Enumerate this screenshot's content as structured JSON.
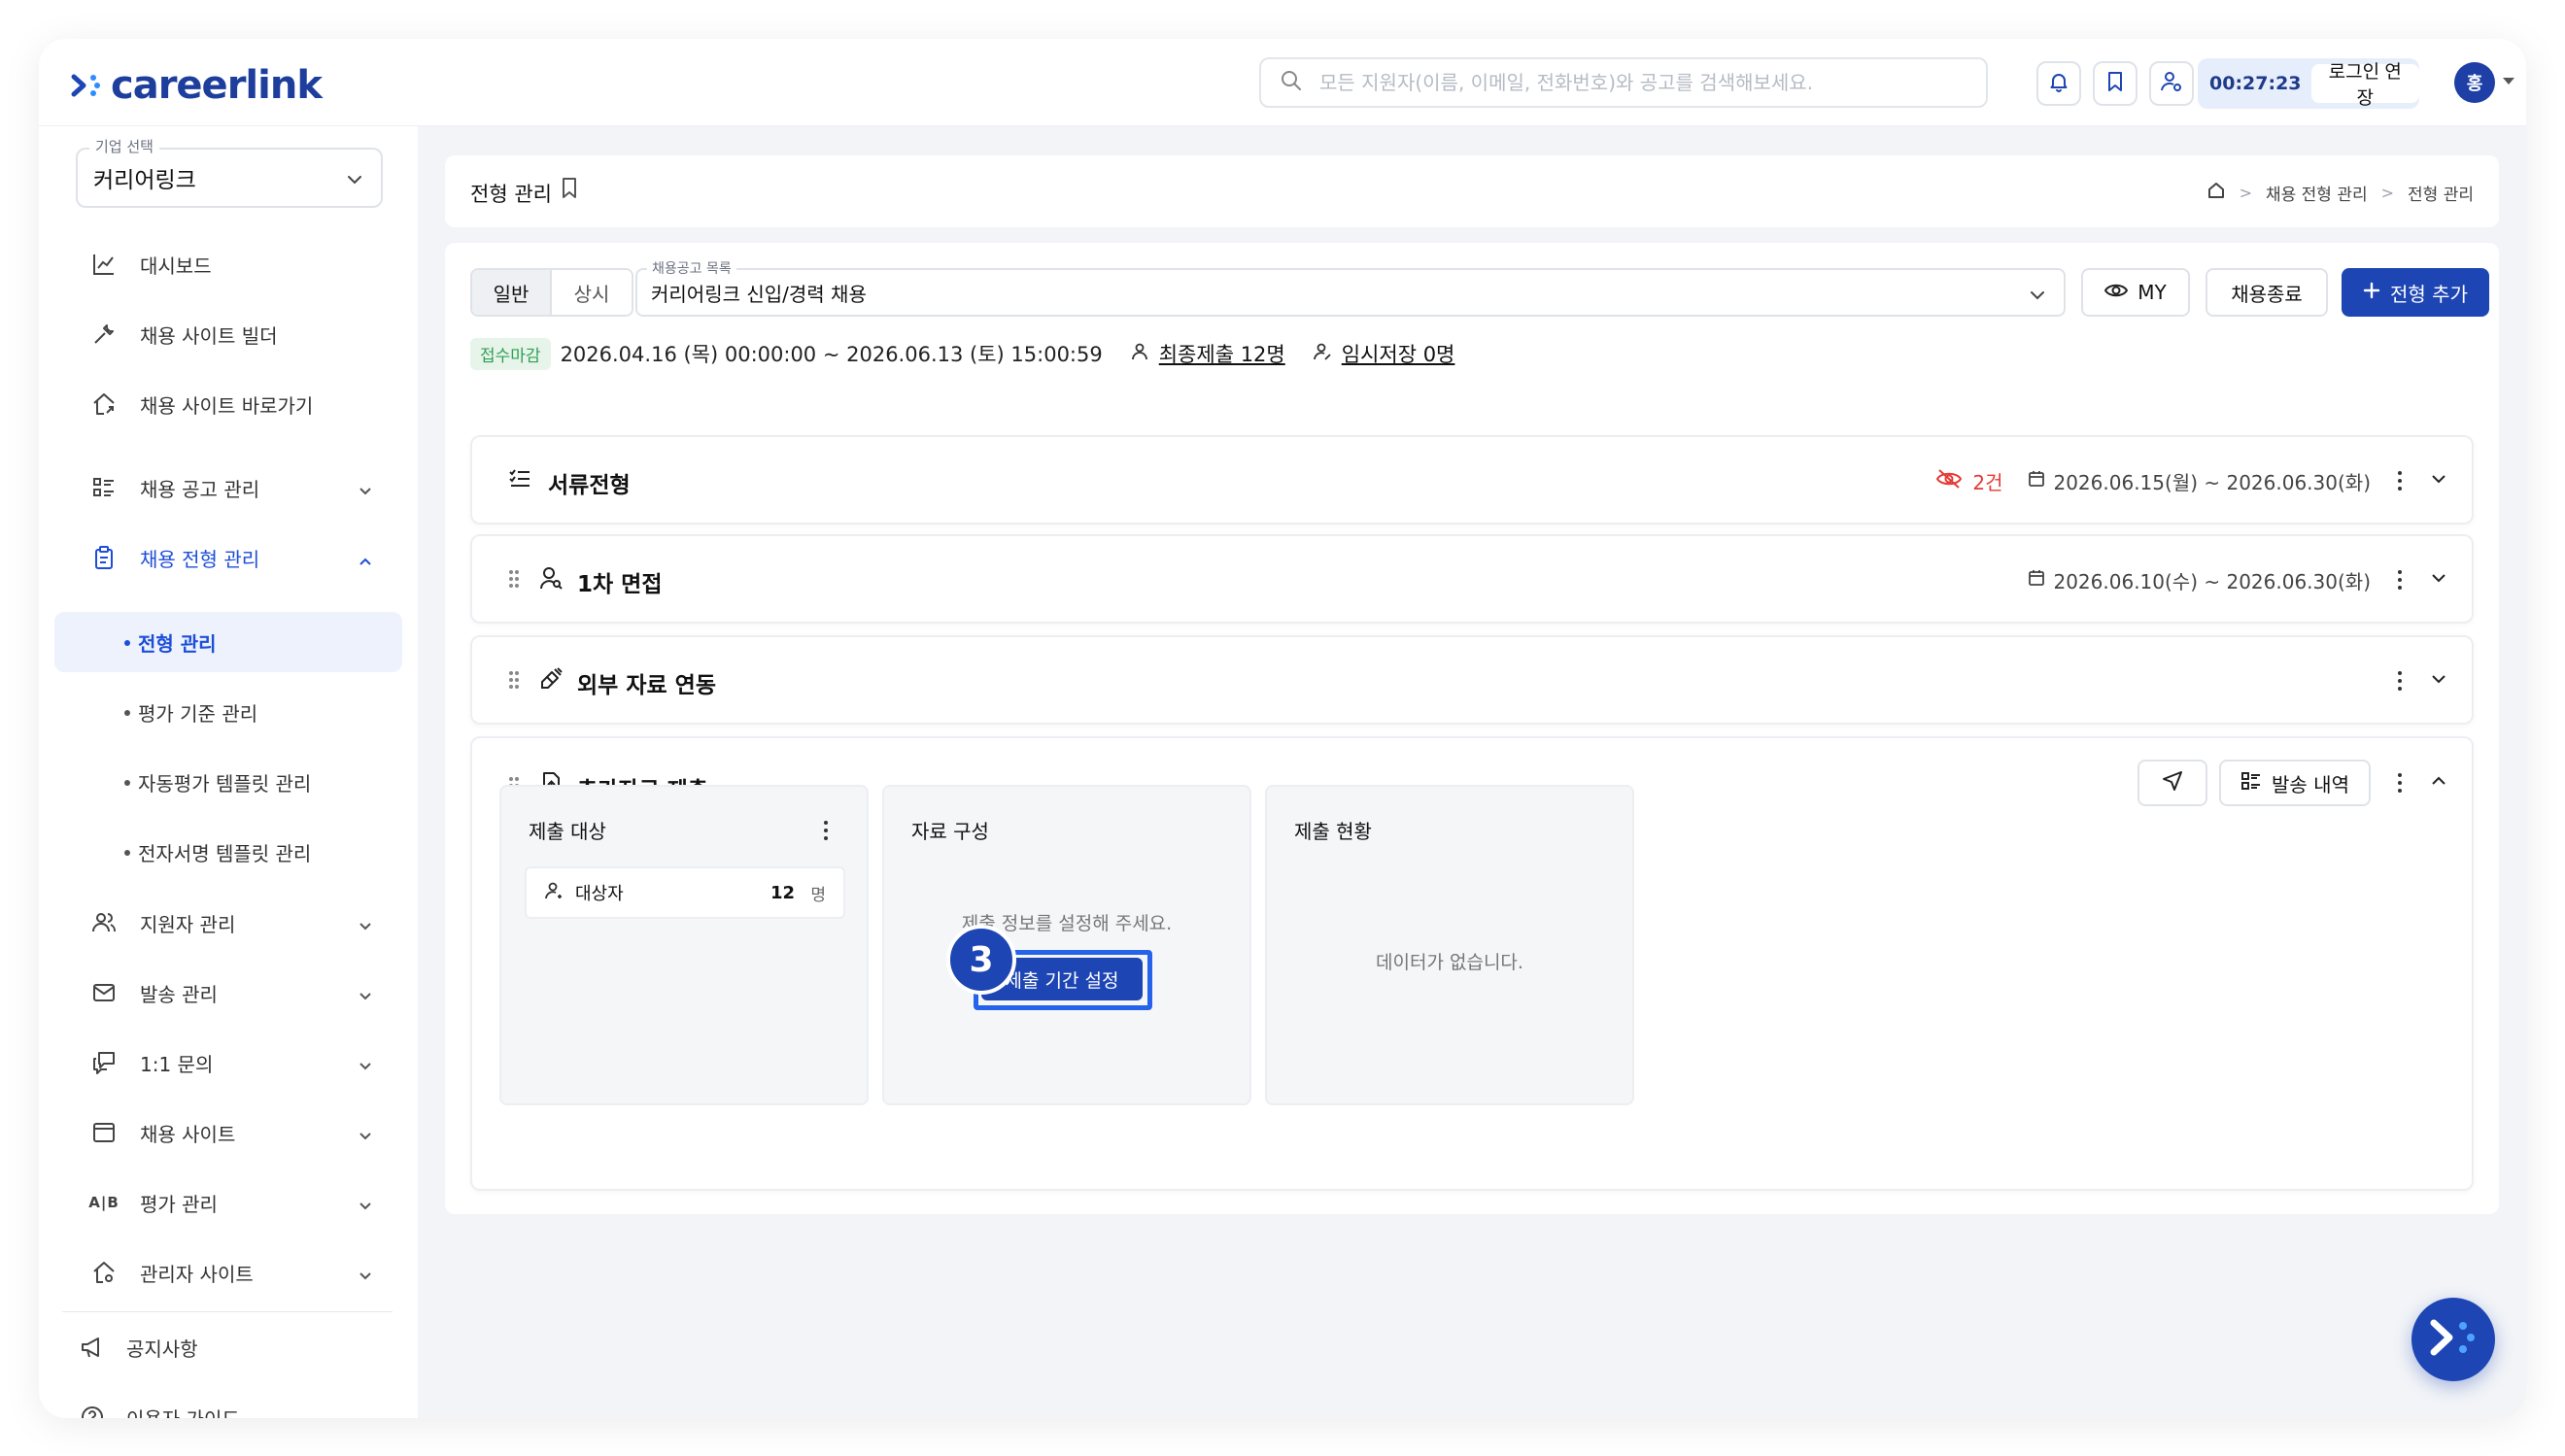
{
  "header": {
    "logo_text": "careerlink",
    "search_placeholder": "모든 지원자(이름, 이메일, 전화번호)와 공고를 검색해보세요.",
    "timer": "00:27:23",
    "extend_login": "로그인 연장",
    "avatar_initial": "홍"
  },
  "sidebar": {
    "company_legend": "기업 선택",
    "company_value": "커리어링크",
    "items": [
      {
        "label": "대시보드",
        "icon": "chart-icon"
      },
      {
        "label": "채용 사이트 빌더",
        "icon": "wrench-icon"
      },
      {
        "label": "채용 사이트 바로가기",
        "icon": "home-link-icon"
      },
      {
        "label": "채용 공고 관리",
        "icon": "list-icon"
      },
      {
        "label": "채용 전형 관리",
        "icon": "clipboard-icon"
      },
      {
        "label": "지원자 관리",
        "icon": "users-icon"
      },
      {
        "label": "발송 관리",
        "icon": "mail-icon"
      },
      {
        "label": "1:1 문의",
        "icon": "chat-icon"
      },
      {
        "label": "채용 사이트",
        "icon": "window-icon"
      },
      {
        "label": "평가 관리",
        "icon": "ab-icon"
      },
      {
        "label": "관리자 사이트",
        "icon": "admin-home-icon"
      }
    ],
    "subitems": [
      "전형 관리",
      "평가 기준 관리",
      "자동평가 템플릿 관리",
      "전자서명 템플릿 관리"
    ],
    "footer": [
      "공지사항",
      "이용자 가이드"
    ]
  },
  "page": {
    "title": "전형 관리",
    "breadcrumb": [
      "채용 전형 관리",
      "전형 관리"
    ]
  },
  "toolbar": {
    "seg_general": "일반",
    "seg_always": "상시",
    "posting_legend": "채용공고 목록",
    "posting_value": "커리어링크 신입/경력 채용",
    "my_label": "MY",
    "close_label": "채용종료",
    "add_stage_label": "전형 추가"
  },
  "status": {
    "badge": "접수마감",
    "period": "2026.04.16 (목) 00:00:00 ~ 2026.06.13 (토) 15:00:59",
    "final_submit": "최종제출 12명",
    "temp_save": "임시저장 0명"
  },
  "stages": [
    {
      "title": "서류전형",
      "hidden_count": "2건",
      "period": "2026.06.15(월) ~ 2026.06.30(화)"
    },
    {
      "title": "1차 면접",
      "period": "2026.06.10(수) ~ 2026.06.30(화)"
    },
    {
      "title": "외부 자료 연동"
    },
    {
      "title": "추가자료 제출",
      "history_label": "발송 내역"
    }
  ],
  "panels": {
    "target_title": "제출 대상",
    "target_row_label": "대상자",
    "target_count": "12",
    "target_unit": "명",
    "config_title": "자료 구성",
    "config_msg": "제출 정보를 설정해 주세요.",
    "config_button": "제출 기간 설정",
    "status_title": "제출 현황",
    "status_msg": "데이터가 없습니다.",
    "step_number": "3"
  },
  "colors": {
    "brand": "#1d45b4",
    "accent_blue": "#1d4ed8",
    "badge_green": "#2f9e55",
    "alert_red": "#e53935"
  }
}
